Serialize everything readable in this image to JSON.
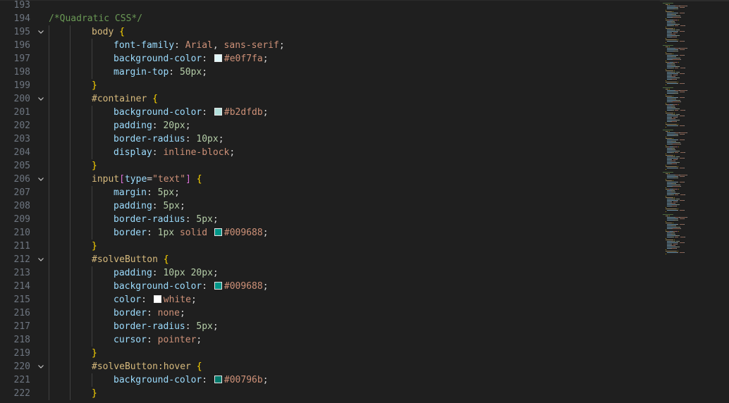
{
  "colors": {
    "editor_bg": "#1f1f1f",
    "line_number": "#6e7681",
    "comment": "#6a9955",
    "selector": "#d7ba7d",
    "property": "#9cdcfe",
    "number": "#b5cea8",
    "value": "#ce9178",
    "brace": "#ffd700",
    "bracket": "#da70d6"
  },
  "editor": {
    "lines": [
      {
        "n": "193",
        "indent": 0,
        "fold": false,
        "tokens": []
      },
      {
        "n": "194",
        "indent": 0,
        "fold": false,
        "tokens": [
          {
            "t": "/*Quadratic CSS*/",
            "c": "comment"
          }
        ]
      },
      {
        "n": "195",
        "indent": 2,
        "fold": true,
        "tokens": [
          {
            "t": "body",
            "c": "sel-tag"
          },
          {
            "t": " ",
            "c": "punc"
          },
          {
            "t": "{",
            "c": "brace"
          }
        ]
      },
      {
        "n": "196",
        "indent": 3,
        "fold": false,
        "tokens": [
          {
            "t": "font-family",
            "c": "prop"
          },
          {
            "t": ": ",
            "c": "punc"
          },
          {
            "t": "Arial",
            "c": "val"
          },
          {
            "t": ", ",
            "c": "punc"
          },
          {
            "t": "sans-serif",
            "c": "val"
          },
          {
            "t": ";",
            "c": "punc"
          }
        ]
      },
      {
        "n": "197",
        "indent": 3,
        "fold": false,
        "tokens": [
          {
            "t": "background-color",
            "c": "prop"
          },
          {
            "t": ": ",
            "c": "punc"
          },
          {
            "swatch": "#e0f7fa"
          },
          {
            "t": "#e0f7fa",
            "c": "val"
          },
          {
            "t": ";",
            "c": "punc"
          }
        ]
      },
      {
        "n": "198",
        "indent": 3,
        "fold": false,
        "tokens": [
          {
            "t": "margin-top",
            "c": "prop"
          },
          {
            "t": ": ",
            "c": "punc"
          },
          {
            "t": "50px",
            "c": "num"
          },
          {
            "t": ";",
            "c": "punc"
          }
        ]
      },
      {
        "n": "199",
        "indent": 2,
        "fold": false,
        "tokens": [
          {
            "t": "}",
            "c": "brace"
          }
        ]
      },
      {
        "n": "200",
        "indent": 2,
        "fold": true,
        "tokens": [
          {
            "t": "#container",
            "c": "sel-id"
          },
          {
            "t": " ",
            "c": "punc"
          },
          {
            "t": "{",
            "c": "brace"
          }
        ]
      },
      {
        "n": "201",
        "indent": 3,
        "fold": false,
        "tokens": [
          {
            "t": "background-color",
            "c": "prop"
          },
          {
            "t": ": ",
            "c": "punc"
          },
          {
            "swatch": "#b2dfdb"
          },
          {
            "t": "#b2dfdb",
            "c": "val"
          },
          {
            "t": ";",
            "c": "punc"
          }
        ]
      },
      {
        "n": "202",
        "indent": 3,
        "fold": false,
        "tokens": [
          {
            "t": "padding",
            "c": "prop"
          },
          {
            "t": ": ",
            "c": "punc"
          },
          {
            "t": "20px",
            "c": "num"
          },
          {
            "t": ";",
            "c": "punc"
          }
        ]
      },
      {
        "n": "203",
        "indent": 3,
        "fold": false,
        "tokens": [
          {
            "t": "border-radius",
            "c": "prop"
          },
          {
            "t": ": ",
            "c": "punc"
          },
          {
            "t": "10px",
            "c": "num"
          },
          {
            "t": ";",
            "c": "punc"
          }
        ]
      },
      {
        "n": "204",
        "indent": 3,
        "fold": false,
        "tokens": [
          {
            "t": "display",
            "c": "prop"
          },
          {
            "t": ": ",
            "c": "punc"
          },
          {
            "t": "inline-block",
            "c": "val"
          },
          {
            "t": ";",
            "c": "punc"
          }
        ]
      },
      {
        "n": "205",
        "indent": 2,
        "fold": false,
        "tokens": [
          {
            "t": "}",
            "c": "brace"
          }
        ]
      },
      {
        "n": "206",
        "indent": 2,
        "fold": true,
        "tokens": [
          {
            "t": "input",
            "c": "sel-tag"
          },
          {
            "t": "[",
            "c": "bracket"
          },
          {
            "t": "type",
            "c": "prop"
          },
          {
            "t": "=",
            "c": "punc"
          },
          {
            "t": "\"text\"",
            "c": "str"
          },
          {
            "t": "]",
            "c": "bracket"
          },
          {
            "t": " ",
            "c": "punc"
          },
          {
            "t": "{",
            "c": "brace"
          }
        ]
      },
      {
        "n": "207",
        "indent": 3,
        "fold": false,
        "tokens": [
          {
            "t": "margin",
            "c": "prop"
          },
          {
            "t": ": ",
            "c": "punc"
          },
          {
            "t": "5px",
            "c": "num"
          },
          {
            "t": ";",
            "c": "punc"
          }
        ]
      },
      {
        "n": "208",
        "indent": 3,
        "fold": false,
        "tokens": [
          {
            "t": "padding",
            "c": "prop"
          },
          {
            "t": ": ",
            "c": "punc"
          },
          {
            "t": "5px",
            "c": "num"
          },
          {
            "t": ";",
            "c": "punc"
          }
        ]
      },
      {
        "n": "209",
        "indent": 3,
        "fold": false,
        "tokens": [
          {
            "t": "border-radius",
            "c": "prop"
          },
          {
            "t": ": ",
            "c": "punc"
          },
          {
            "t": "5px",
            "c": "num"
          },
          {
            "t": ";",
            "c": "punc"
          }
        ]
      },
      {
        "n": "210",
        "indent": 3,
        "fold": false,
        "tokens": [
          {
            "t": "border",
            "c": "prop"
          },
          {
            "t": ": ",
            "c": "punc"
          },
          {
            "t": "1px",
            "c": "num"
          },
          {
            "t": " ",
            "c": "punc"
          },
          {
            "t": "solid",
            "c": "val"
          },
          {
            "t": " ",
            "c": "punc"
          },
          {
            "swatch": "#009688"
          },
          {
            "t": "#009688",
            "c": "val"
          },
          {
            "t": ";",
            "c": "punc"
          }
        ]
      },
      {
        "n": "211",
        "indent": 2,
        "fold": false,
        "tokens": [
          {
            "t": "}",
            "c": "brace"
          }
        ]
      },
      {
        "n": "212",
        "indent": 2,
        "fold": true,
        "tokens": [
          {
            "t": "#solveButton",
            "c": "sel-id"
          },
          {
            "t": " ",
            "c": "punc"
          },
          {
            "t": "{",
            "c": "brace"
          }
        ]
      },
      {
        "n": "213",
        "indent": 3,
        "fold": false,
        "tokens": [
          {
            "t": "padding",
            "c": "prop"
          },
          {
            "t": ": ",
            "c": "punc"
          },
          {
            "t": "10px",
            "c": "num"
          },
          {
            "t": " ",
            "c": "punc"
          },
          {
            "t": "20px",
            "c": "num"
          },
          {
            "t": ";",
            "c": "punc"
          }
        ]
      },
      {
        "n": "214",
        "indent": 3,
        "fold": false,
        "tokens": [
          {
            "t": "background-color",
            "c": "prop"
          },
          {
            "t": ": ",
            "c": "punc"
          },
          {
            "swatch": "#009688"
          },
          {
            "t": "#009688",
            "c": "val"
          },
          {
            "t": ";",
            "c": "punc"
          }
        ]
      },
      {
        "n": "215",
        "indent": 3,
        "fold": false,
        "tokens": [
          {
            "t": "color",
            "c": "prop"
          },
          {
            "t": ": ",
            "c": "punc"
          },
          {
            "swatch": "#ffffff"
          },
          {
            "t": "white",
            "c": "val"
          },
          {
            "t": ";",
            "c": "punc"
          }
        ]
      },
      {
        "n": "216",
        "indent": 3,
        "fold": false,
        "tokens": [
          {
            "t": "border",
            "c": "prop"
          },
          {
            "t": ": ",
            "c": "punc"
          },
          {
            "t": "none",
            "c": "val"
          },
          {
            "t": ";",
            "c": "punc"
          }
        ]
      },
      {
        "n": "217",
        "indent": 3,
        "fold": false,
        "tokens": [
          {
            "t": "border-radius",
            "c": "prop"
          },
          {
            "t": ": ",
            "c": "punc"
          },
          {
            "t": "5px",
            "c": "num"
          },
          {
            "t": ";",
            "c": "punc"
          }
        ]
      },
      {
        "n": "218",
        "indent": 3,
        "fold": false,
        "tokens": [
          {
            "t": "cursor",
            "c": "prop"
          },
          {
            "t": ": ",
            "c": "punc"
          },
          {
            "t": "pointer",
            "c": "val"
          },
          {
            "t": ";",
            "c": "punc"
          }
        ]
      },
      {
        "n": "219",
        "indent": 2,
        "fold": false,
        "tokens": [
          {
            "t": "}",
            "c": "brace"
          }
        ]
      },
      {
        "n": "220",
        "indent": 2,
        "fold": true,
        "tokens": [
          {
            "t": "#solveButton:hover",
            "c": "sel-id"
          },
          {
            "t": " ",
            "c": "punc"
          },
          {
            "t": "{",
            "c": "brace"
          }
        ]
      },
      {
        "n": "221",
        "indent": 3,
        "fold": false,
        "tokens": [
          {
            "t": "background-color",
            "c": "prop"
          },
          {
            "t": ": ",
            "c": "punc"
          },
          {
            "swatch": "#00796b"
          },
          {
            "t": "#00796b",
            "c": "val"
          },
          {
            "t": ";",
            "c": "punc"
          }
        ]
      },
      {
        "n": "222",
        "indent": 2,
        "fold": false,
        "tokens": [
          {
            "t": "}",
            "c": "brace"
          }
        ]
      }
    ],
    "fold_icon": "chevron-down-icon"
  }
}
